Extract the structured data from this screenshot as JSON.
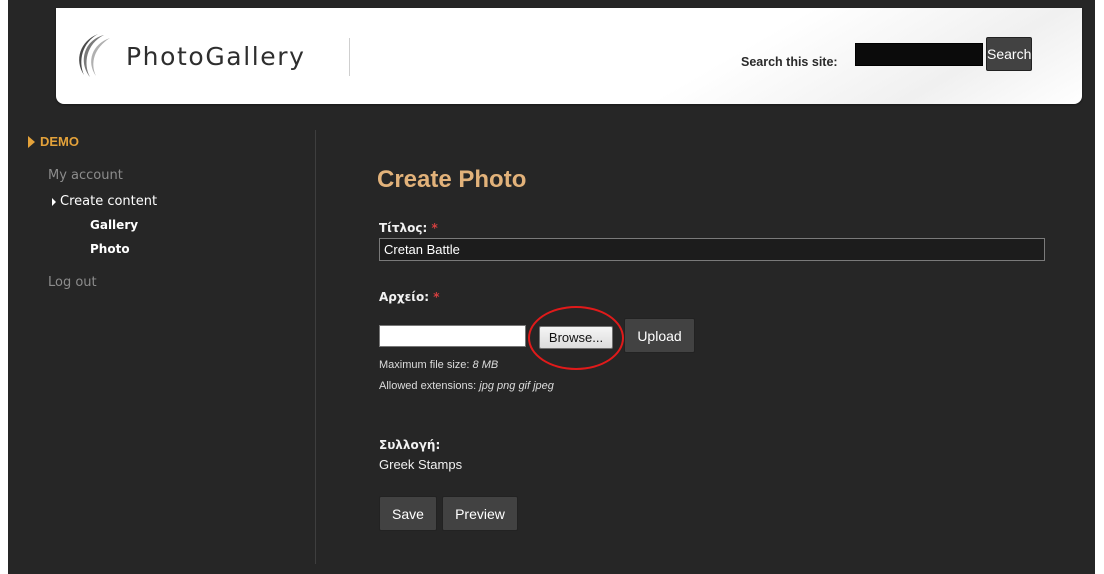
{
  "header": {
    "site_name": "PhotoGallery",
    "logo_icon": "crescent-swoosh-icon",
    "search": {
      "label": "Search this site:",
      "value": "",
      "button_label": "Search"
    }
  },
  "sidebar": {
    "section_title": "DEMO",
    "items": [
      {
        "label": "My account"
      },
      {
        "label": "Create content"
      },
      {
        "label": "Gallery"
      },
      {
        "label": "Photo"
      },
      {
        "label": "Log out"
      }
    ]
  },
  "main": {
    "title": "Create Photo",
    "title_field": {
      "label": "Τίτλος:",
      "required_mark": "*",
      "value": "Cretan Battle"
    },
    "file_field": {
      "label": "Αρχείο:",
      "required_mark": "*",
      "browse_label": "Browse...",
      "upload_label": "Upload",
      "max_size_label": "Maximum file size:",
      "max_size_value": "8 MB",
      "extensions_label": "Allowed extensions:",
      "extensions_value": "jpg png gif jpeg"
    },
    "collection": {
      "label": "Συλλογή:",
      "value": "Greek Stamps"
    },
    "actions": {
      "save_label": "Save",
      "preview_label": "Preview"
    }
  },
  "colors": {
    "accent": "#e4a23a",
    "title": "#e2b27a",
    "background": "#262626",
    "highlight": "#e01a1a"
  }
}
